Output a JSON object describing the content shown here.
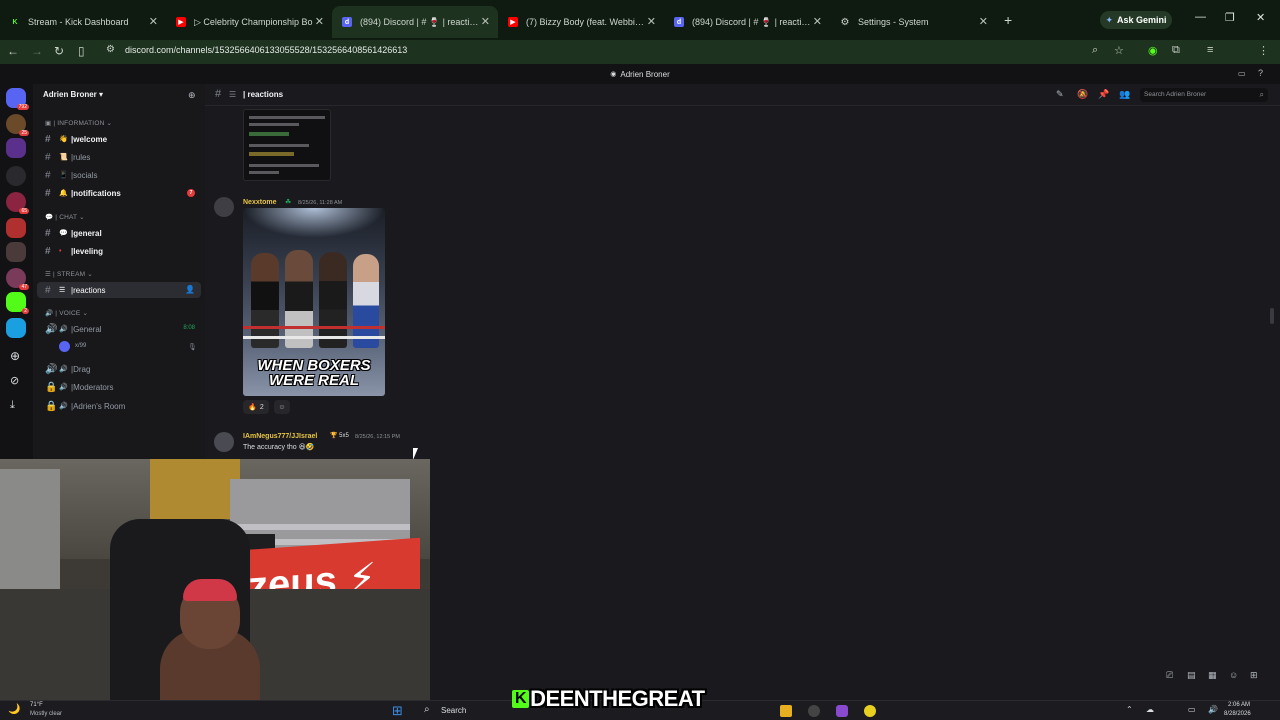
{
  "browser": {
    "tabs": [
      {
        "title": "Stream - Kick Dashboard",
        "icon": "kick-icon",
        "color": "#53fc18"
      },
      {
        "title": "▷ Celebrity Championship Bo",
        "icon": "youtube-icon",
        "color": "#ff0000"
      },
      {
        "title": "(894) Discord | # 🍷 | reactions",
        "icon": "discord-icon",
        "color": "#5865f2",
        "active": true
      },
      {
        "title": "(7) Bizzy Body (feat. Webbie &",
        "icon": "youtube-icon",
        "color": "#ff0000"
      },
      {
        "title": "(894) Discord | # 🍷 | reactions",
        "icon": "discord-icon",
        "color": "#5865f2"
      },
      {
        "title": "Settings - System",
        "icon": "gear-icon",
        "color": "#9aa0a6"
      }
    ],
    "gemini_label": "Ask Gemini",
    "url": "discord.com/channels/1532566406133055528/1532566408561426613"
  },
  "discord": {
    "window_title": "Adrien Broner",
    "server_name": "Adrien Broner",
    "server_badges": [
      "792",
      "25",
      "65",
      "47",
      "2"
    ],
    "categories": {
      "information": "INFORMATION",
      "chat": "CHAT",
      "stream": "STREAM",
      "voice": "VOICE"
    },
    "channels": {
      "welcome": "welcome",
      "rules": "rules",
      "socials": "socials",
      "notifications": "notifications",
      "notifications_badge": "7",
      "general": "general",
      "leveling": "leveling",
      "reactions": "reactions",
      "voice_general": "General",
      "voice_general_time": "8:08",
      "voice_user": "x/99",
      "drag": "Drag",
      "moderators": "Moderators",
      "adriens_room": "Adrien's Room"
    },
    "header": {
      "channel": "reactions",
      "search_placeholder": "Search Adrien Broner"
    },
    "messages": [
      {
        "username": "Nexxtome",
        "timestamp": "8/25/26, 11:28 AM",
        "image_caption": "WHEN BOXERS WERE REAL",
        "reaction_count": "2"
      },
      {
        "username": "IAmNegus777/JJIsrael",
        "tag": "5x5",
        "timestamp": "8/25/26, 12:15 PM",
        "text": "The accuracy tho 😆🤣"
      }
    ]
  },
  "overlay_text": "DEENTHEGREAT",
  "overlay_k": "K",
  "taskbar": {
    "weather_temp": "71°F",
    "weather_desc": "Mostly clear",
    "search_label": "Search",
    "time": "2:06 AM",
    "date": "8/28/2026"
  },
  "colors": {
    "discord_bg": "#1a1a1e",
    "sidebar_bg": "#18181b",
    "kick_green": "#53fc18",
    "badge_red": "#e23c3c",
    "username_yellow": "#e8c547"
  }
}
